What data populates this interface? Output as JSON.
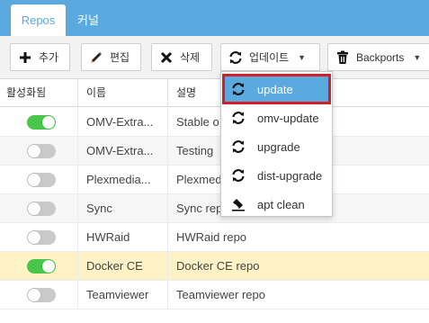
{
  "tabs": [
    {
      "label": "Repos",
      "active": true
    },
    {
      "label": "커널",
      "active": false
    }
  ],
  "toolbar": {
    "add_label": "추가",
    "edit_label": "편집",
    "delete_label": "삭제",
    "update_label": "업데이트",
    "backports_label": "Backports"
  },
  "table": {
    "headers": [
      "활성화됨",
      "이름",
      "설명"
    ],
    "rows": [
      {
        "enabled": true,
        "name": "OMV-Extra...",
        "description": "Stable o",
        "selected": false
      },
      {
        "enabled": false,
        "name": "OMV-Extra...",
        "description": "Testing",
        "selected": false
      },
      {
        "enabled": false,
        "name": "Plexmedia...",
        "description": "Plexmed",
        "selected": false
      },
      {
        "enabled": false,
        "name": "Sync",
        "description": "Sync repo",
        "selected": false
      },
      {
        "enabled": false,
        "name": "HWRaid",
        "description": "HWRaid repo",
        "selected": false
      },
      {
        "enabled": true,
        "name": "Docker CE",
        "description": "Docker CE repo",
        "selected": true
      },
      {
        "enabled": false,
        "name": "Teamviewer",
        "description": "Teamviewer repo",
        "selected": false
      }
    ]
  },
  "update_menu": {
    "items": [
      {
        "label": "update",
        "icon": "refresh-icon",
        "highlighted": true
      },
      {
        "label": "omv-update",
        "icon": "refresh-icon",
        "highlighted": false
      },
      {
        "label": "upgrade",
        "icon": "refresh-icon",
        "highlighted": false
      },
      {
        "label": "dist-upgrade",
        "icon": "refresh-icon",
        "highlighted": false
      },
      {
        "label": "apt clean",
        "icon": "eraser-icon",
        "highlighted": false
      }
    ]
  },
  "colors": {
    "accent": "#5aa9df",
    "toggle_on": "#47c64a",
    "toggle_off": "#c9c9c9",
    "selected_row": "#fdf2c6",
    "highlight_border": "#d0202a"
  }
}
